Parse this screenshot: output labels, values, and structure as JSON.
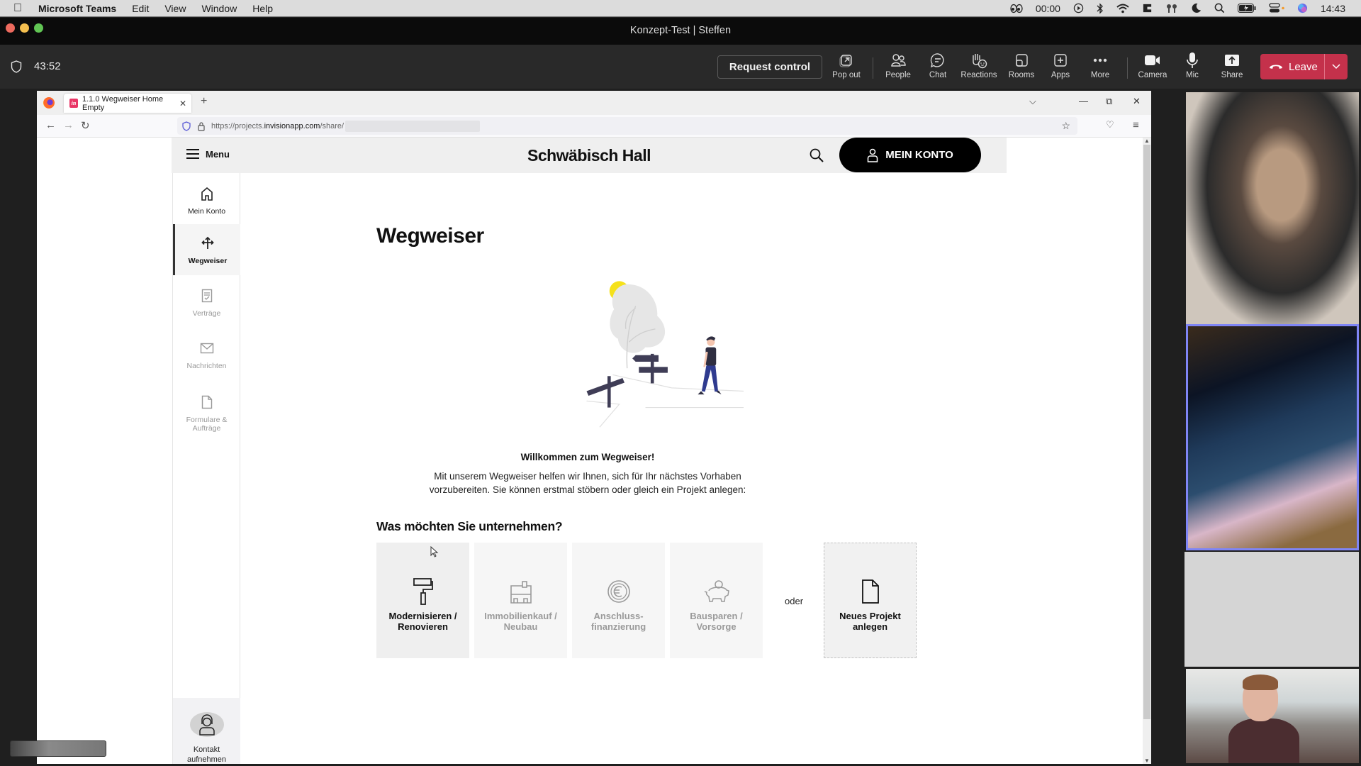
{
  "menubar": {
    "app_name": "Microsoft Teams",
    "items": [
      "Edit",
      "View",
      "Window",
      "Help"
    ],
    "status_timer": "00:00",
    "clock": "14:43"
  },
  "window": {
    "title": "Konzept-Test | Steffen"
  },
  "toolbar": {
    "meeting_timer": "43:52",
    "request_control": "Request control",
    "buttons": [
      {
        "label": "Pop out",
        "icon": "pop-out-icon"
      },
      {
        "label": "People",
        "icon": "people-icon"
      },
      {
        "label": "Chat",
        "icon": "chat-icon"
      },
      {
        "label": "Reactions",
        "icon": "reactions-icon"
      },
      {
        "label": "Rooms",
        "icon": "rooms-icon"
      },
      {
        "label": "Apps",
        "icon": "apps-icon"
      },
      {
        "label": "More",
        "icon": "more-icon"
      },
      {
        "label": "Camera",
        "icon": "camera-icon"
      },
      {
        "label": "Mic",
        "icon": "mic-icon"
      },
      {
        "label": "Share",
        "icon": "share-icon"
      }
    ],
    "leave": "Leave",
    "leave_color": "#c4314b"
  },
  "browser": {
    "tab_title": "1.1.0 Wegweiser Home Empty",
    "tab_favicon": "in",
    "url_prefix": "https://projects.",
    "url_host": "invisionapp.com",
    "url_path": "/share/"
  },
  "site": {
    "menu_label": "Menu",
    "brand": "Schwäbisch Hall",
    "account_button": "MEIN KONTO",
    "sidenav": [
      {
        "label": "Mein Konto",
        "icon": "home-icon",
        "state": "normal"
      },
      {
        "label": "Wegweiser",
        "icon": "directions-icon",
        "state": "active"
      },
      {
        "label": "Verträge",
        "icon": "contract-icon",
        "state": "dim"
      },
      {
        "label": "Nachrichten",
        "icon": "mail-icon",
        "state": "dim"
      },
      {
        "label": "Formulare & Aufträge",
        "icon": "document-icon",
        "state": "dim"
      }
    ],
    "contact_label_1": "Kontakt",
    "contact_label_2": "aufnehmen",
    "page_title": "Wegweiser",
    "welcome_title": "Willkommen zum Wegweiser!",
    "welcome_line_1": "Mit unserem Wegweiser helfen wir Ihnen, sich für Ihr nächstes Vorhaben",
    "welcome_line_2": "vorzubereiten. Sie können erstmal stöbern oder gleich ein Projekt anlegen:",
    "section_title": "Was möchten Sie unternehmen?",
    "cards": [
      {
        "line1": "Modernisieren /",
        "line2": "Renovieren",
        "icon": "paint-roller-icon",
        "state": "active"
      },
      {
        "line1": "Immobilienkauf /",
        "line2": "Neubau",
        "icon": "house-icon",
        "state": "dim"
      },
      {
        "line1": "Anschluss-",
        "line2": "finanzierung",
        "icon": "euro-coin-icon",
        "state": "dim"
      },
      {
        "line1": "Bausparen /",
        "line2": "Vorsorge",
        "icon": "piggy-bank-icon",
        "state": "dim"
      }
    ],
    "or_label": "oder",
    "new_project_1": "Neues Projekt",
    "new_project_2": "anlegen"
  },
  "colors": {
    "active_speaker_border": "#7f85f5",
    "illustration_sun": "#f5e11b",
    "illustration_accent": "#3f3d56",
    "illustration_pants": "#2f3b8f"
  }
}
